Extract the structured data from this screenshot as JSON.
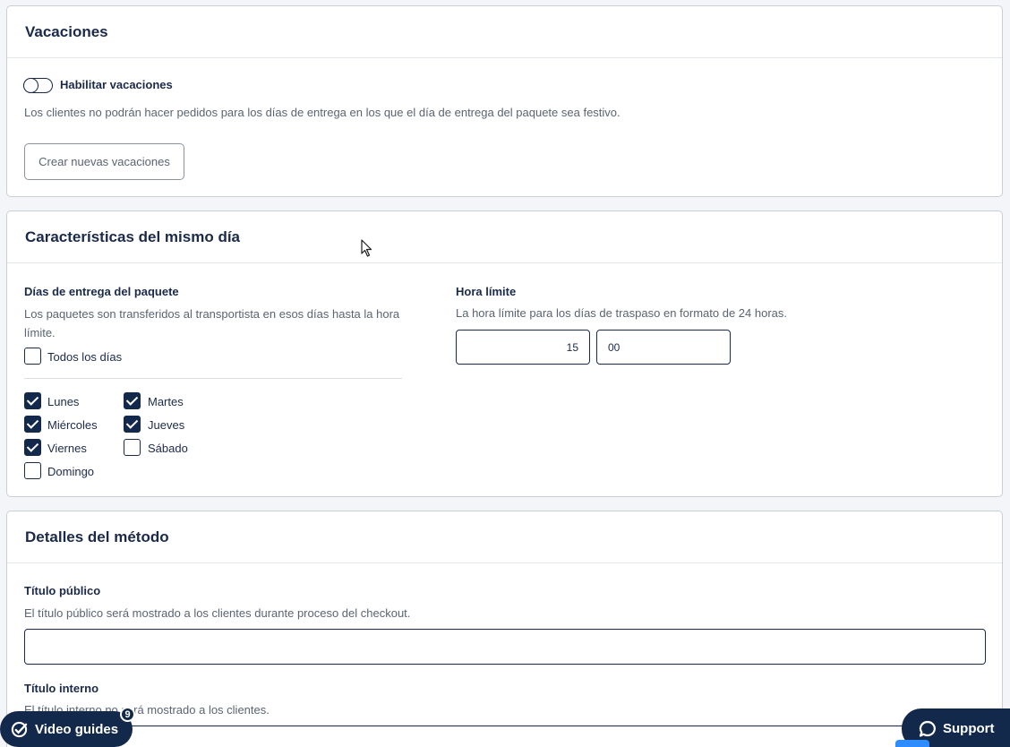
{
  "vacations": {
    "title": "Vacaciones",
    "toggle_label": "Habilitar vacaciones",
    "toggle_on": false,
    "description": "Los clientes no podrán hacer pedidos para los días de entrega en los que el día de entrega del paquete sea festivo.",
    "create_button": "Crear nuevas vacaciones"
  },
  "same_day": {
    "title": "Características del mismo día",
    "delivery_days": {
      "label": "Días de entrega del paquete",
      "help": "Los paquetes son transferidos al transportista en esos días hasta la hora límite.",
      "all_days_label": "Todos los días",
      "all_days_checked": false,
      "days": [
        {
          "label": "Lunes",
          "checked": true
        },
        {
          "label": "Martes",
          "checked": true
        },
        {
          "label": "Miércoles",
          "checked": true
        },
        {
          "label": "Jueves",
          "checked": true
        },
        {
          "label": "Viernes",
          "checked": true
        },
        {
          "label": "Sábado",
          "checked": false
        },
        {
          "label": "Domingo",
          "checked": false
        }
      ]
    },
    "cutoff": {
      "label": "Hora límite",
      "help": "La hora límite para los días de traspaso en formato de 24 horas.",
      "hour": "15",
      "minute": "00"
    }
  },
  "method": {
    "title": "Detalles del método",
    "public_title_label": "Título público",
    "public_title_help": "El título público será mostrado a los clientes durante proceso del checkout.",
    "public_title_value": "",
    "internal_title_label": "Título interno",
    "internal_title_help": "El título interno no será mostrado a los clientes."
  },
  "floating": {
    "video_guides_label": "Video guides",
    "video_guides_count": "9",
    "support_label": "Support"
  }
}
